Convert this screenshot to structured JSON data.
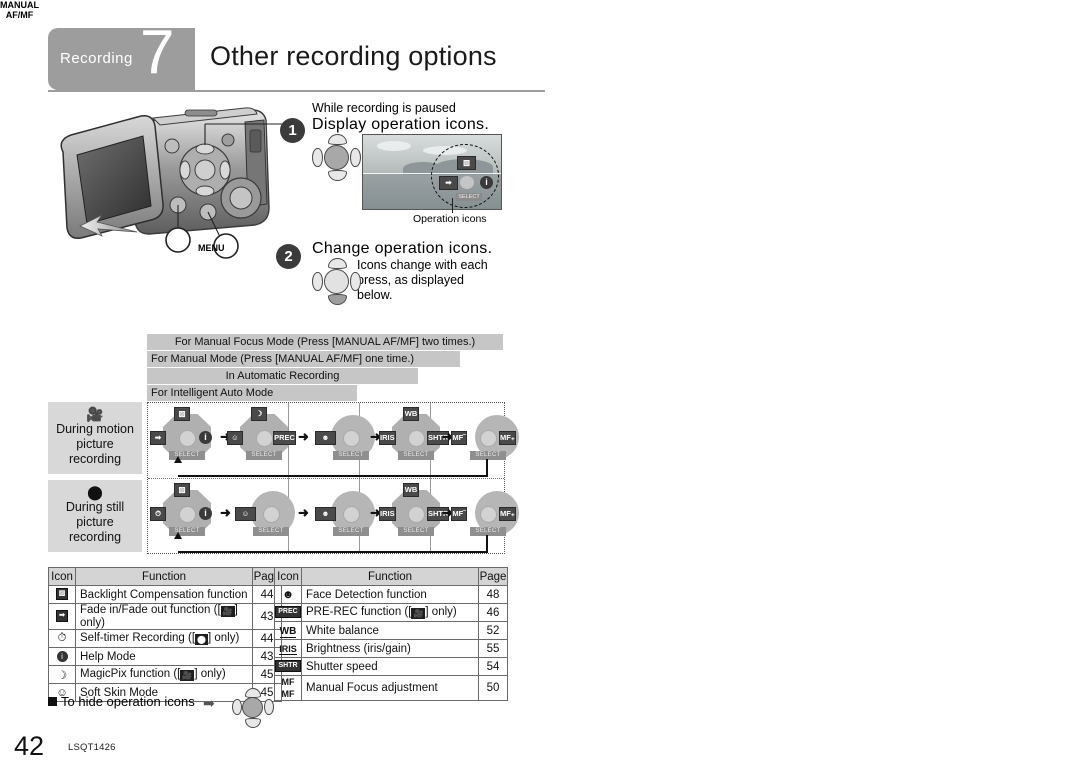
{
  "header": {
    "category": "Recording",
    "number": "7",
    "title": "Other recording options"
  },
  "illustration": {
    "button_manual_line1": "MANUAL",
    "button_manual_line2": "AF/MF",
    "button_menu": "MENU"
  },
  "steps": [
    {
      "number": "1",
      "precondition": "While recording is paused",
      "instruction": "Display operation icons.",
      "caption": "Operation icons"
    },
    {
      "number": "2",
      "instruction": "Change operation icons.",
      "note_line1": "Icons change with each",
      "note_line2": "press, as displayed",
      "note_line3": "below."
    }
  ],
  "diagram": {
    "mode_bars": [
      "For Manual Focus Mode (Press [MANUAL AF/MF] two times.)",
      "For Manual Mode (Press [MANUAL AF/MF] one time.)",
      "In Automatic Recording",
      "For Intelligent Auto Mode"
    ],
    "rows": [
      {
        "icon": "Ἲ5",
        "label_line1": "During motion",
        "label_line2": "picture",
        "label_line3": "recording",
        "select_label": "SELECT"
      },
      {
        "icon": "camera",
        "label_line1": "During still",
        "label_line2": "picture",
        "label_line3": "recording",
        "select_label": "SELECT"
      }
    ],
    "motion_clusters": [
      {
        "top": "backlight",
        "left": "fade",
        "right": "help"
      },
      {
        "top": "magicpix",
        "left": "softskin",
        "right": "PREC"
      },
      {
        "top": "",
        "left": "face",
        "right": ""
      },
      {
        "top": "WB",
        "left": "IRIS",
        "right": "SHTR"
      },
      {
        "top": "",
        "left": "MF-",
        "right": "MF+"
      }
    ],
    "still_clusters": [
      {
        "top": "backlight",
        "left": "selftimer",
        "right": "help"
      },
      {
        "top": "",
        "left": "softskin",
        "right": ""
      },
      {
        "top": "",
        "left": "face",
        "right": ""
      },
      {
        "top": "WB",
        "left": "IRIS",
        "right": "SHTR"
      },
      {
        "top": "",
        "left": "MF-",
        "right": "MF+"
      }
    ]
  },
  "table_left": {
    "headers": [
      "Icon",
      "Function",
      "Page"
    ],
    "rows": [
      {
        "icon": "backlight-icon",
        "function": "Backlight Compensation function",
        "page": "44"
      },
      {
        "icon": "fade-icon",
        "function": "Fade in/Fade out function ([\u0000] only)",
        "page": "43"
      },
      {
        "icon": "self-timer-icon",
        "function": "Self-timer Recording ([\u0000] only)",
        "page": "44"
      },
      {
        "icon": "help-icon",
        "function": "Help Mode",
        "page": "43"
      },
      {
        "icon": "magicpix-icon",
        "function": "MagicPix function ([\u0000] only)",
        "page": "45"
      },
      {
        "icon": "soft-skin-icon",
        "function": "Soft Skin Mode",
        "page": "45"
      }
    ]
  },
  "table_right": {
    "headers": [
      "Icon",
      "Function",
      "Page"
    ],
    "rows": [
      {
        "icon": "face-detection-icon",
        "function": "Face Detection function",
        "page": "48"
      },
      {
        "icon": "pre-rec-icon",
        "function": "PRE-REC function ([\u0000] only)",
        "page": "46"
      },
      {
        "icon": "white-balance-icon",
        "function": "White balance",
        "page": "52"
      },
      {
        "icon": "iris-icon",
        "function": "Brightness (iris/gain)",
        "page": "55"
      },
      {
        "icon": "shutter-icon",
        "function": "Shutter speed",
        "page": "54"
      },
      {
        "icon": "manual-focus-icon",
        "function": "Manual Focus adjustment",
        "page": "50"
      }
    ]
  },
  "footer": {
    "hide_icons_text": "To hide operation icons",
    "page_number": "42",
    "doc_code": "LSQT1426"
  }
}
